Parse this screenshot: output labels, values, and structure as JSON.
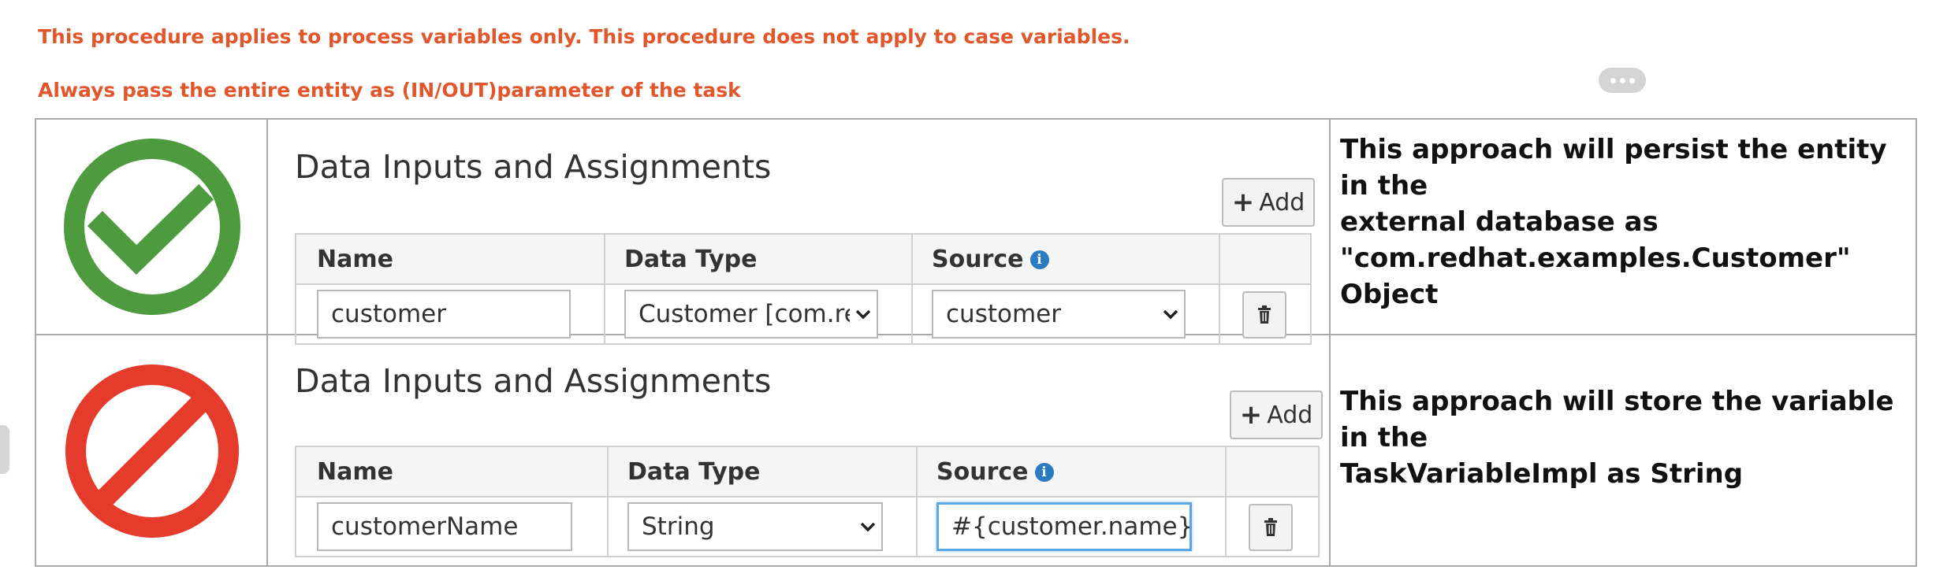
{
  "notices": {
    "line1": "This procedure applies to process variables only. This procedure does not apply to case variables.",
    "line2": "Always pass the entire entity as (IN/OUT)parameter of the task"
  },
  "colors": {
    "notice": "#e2562b",
    "correct_icon": "#4e9a3e",
    "incorrect_icon": "#e43b2c",
    "info_icon": "#2a7bbf"
  },
  "rows": [
    {
      "icon": "check-circle-icon",
      "panel": {
        "title": "Data Inputs and Assignments",
        "add_label": "Add",
        "headers": {
          "name": "Name",
          "data_type": "Data Type",
          "source": "Source"
        },
        "entry": {
          "name": "customer",
          "data_type": "Customer [com.redhat.examples]",
          "source": "customer"
        }
      },
      "description": [
        "This approach will persist the entity in the",
        "external database as",
        "\"com.redhat.examples.Customer\" Object"
      ]
    },
    {
      "icon": "prohibited-icon",
      "panel": {
        "title": "Data Inputs and Assignments",
        "add_label": "Add",
        "headers": {
          "name": "Name",
          "data_type": "Data Type",
          "source": "Source"
        },
        "entry": {
          "name": "customerName",
          "data_type": "String",
          "source": "#{customer.name}"
        }
      },
      "description": [
        "This approach will store the variable in the",
        "TaskVariableImpl as String"
      ]
    }
  ]
}
